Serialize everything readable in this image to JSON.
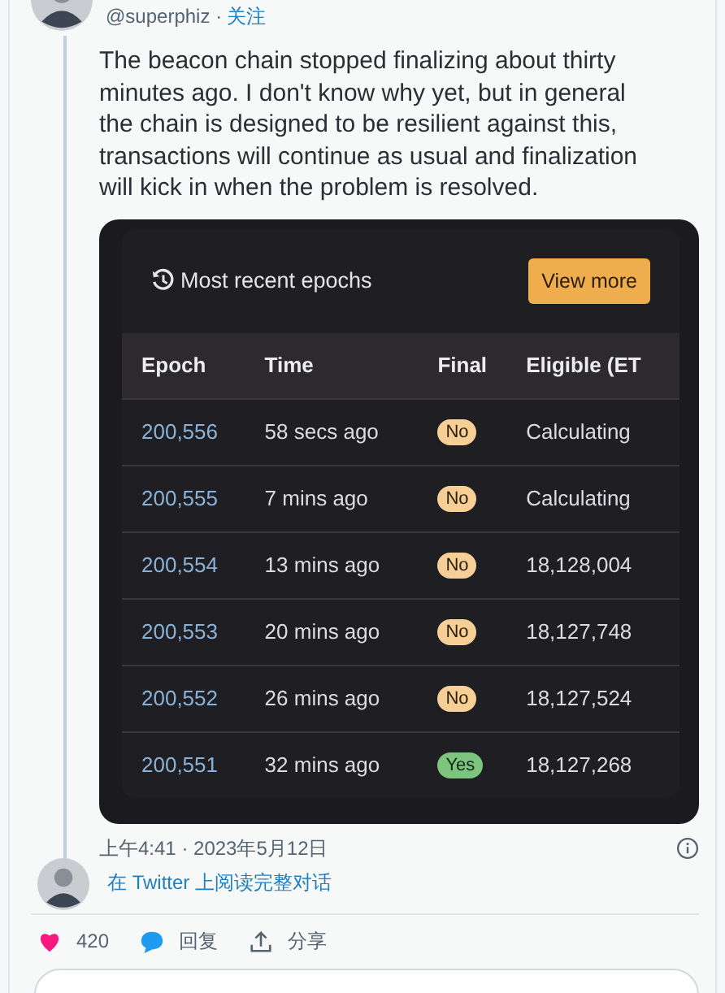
{
  "author": {
    "handle": "@superphiz",
    "separator": "·",
    "follow": "关注"
  },
  "tweet": {
    "text": "The beacon chain stopped finalizing about thirty minutes ago. I don't know why yet, but in general the chain is designed to be resilient against this, transactions will continue as usual and finalization will kick in when the problem is resolved."
  },
  "embed": {
    "title": "Most recent epochs",
    "button": "View more",
    "columns": [
      "Epoch",
      "Time",
      "Final",
      "Eligible (ET"
    ],
    "rows": [
      {
        "epoch": "200,556",
        "time": "58 secs ago",
        "final": "No",
        "finalized": false,
        "eligible": "Calculating"
      },
      {
        "epoch": "200,555",
        "time": "7 mins ago",
        "final": "No",
        "finalized": false,
        "eligible": "Calculating"
      },
      {
        "epoch": "200,554",
        "time": "13 mins ago",
        "final": "No",
        "finalized": false,
        "eligible": "18,128,004"
      },
      {
        "epoch": "200,553",
        "time": "20 mins ago",
        "final": "No",
        "finalized": false,
        "eligible": "18,127,748"
      },
      {
        "epoch": "200,552",
        "time": "26 mins ago",
        "final": "No",
        "finalized": false,
        "eligible": "18,127,524"
      },
      {
        "epoch": "200,551",
        "time": "32 mins ago",
        "final": "Yes",
        "finalized": true,
        "eligible": "18,127,268"
      }
    ]
  },
  "timestamp": "上午4:41 · 2023年5月12日",
  "thread_link": "在 Twitter 上阅读完整对话",
  "actions": {
    "likes": "420",
    "reply": "回复",
    "share": "分享"
  }
}
